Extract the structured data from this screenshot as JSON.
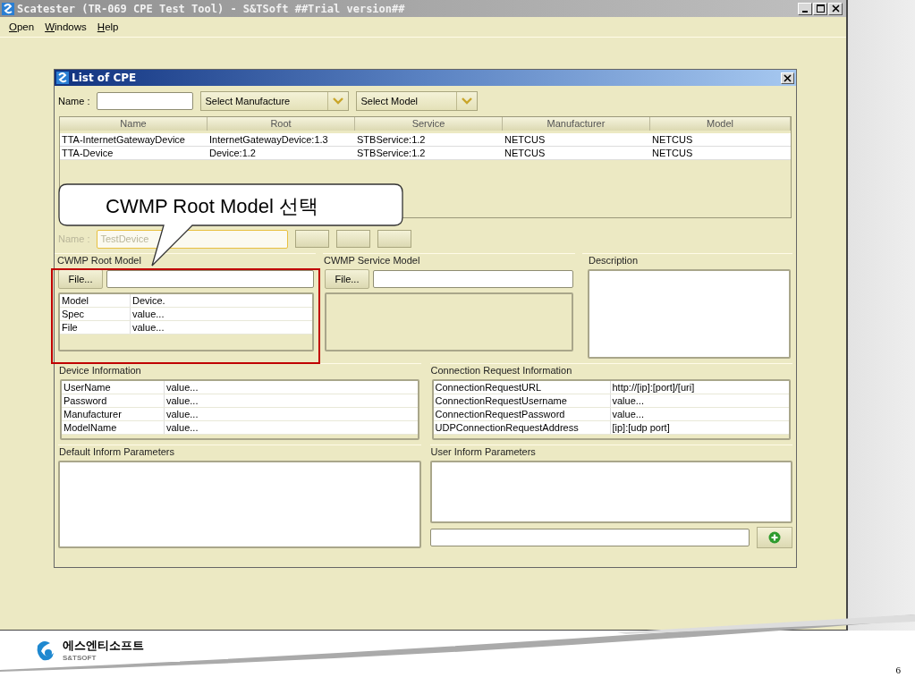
{
  "window": {
    "title": "Scatester (TR-069 CPE Test Tool) - S&TSoft ##Trial version##"
  },
  "menu": [
    {
      "key": "O",
      "rest": "pen"
    },
    {
      "key": "W",
      "rest": "indows"
    },
    {
      "key": "H",
      "rest": "elp"
    }
  ],
  "dialog": {
    "title": "List of CPE",
    "filter": {
      "name_label": "Name :",
      "manufacturer": "Select Manufacture",
      "model": "Select Model"
    },
    "table": {
      "columns": [
        "Name",
        "Root",
        "Service",
        "Manufacturer",
        "Model"
      ],
      "rows": [
        [
          "TTA-InternetGatewayDevice",
          "InternetGatewayDevice:1.3",
          "STBService:1.2",
          "NETCUS",
          "NETCUS"
        ],
        [
          "TTA-Device",
          "Device:1.2",
          "STBService:1.2",
          "NETCUS",
          "NETCUS"
        ]
      ]
    },
    "device": {
      "name_label": "Name :",
      "name_value": "TestDevice",
      "disabled": true
    },
    "root_model": {
      "title": "CWMP Root Model",
      "file_button": "File...",
      "properties": [
        [
          "Model",
          "Device."
        ],
        [
          "Spec",
          "value..."
        ],
        [
          "File",
          "value..."
        ]
      ]
    },
    "service_model": {
      "title": "CWMP Service Model",
      "file_button": "File..."
    },
    "description": {
      "title": "Description"
    },
    "device_information": {
      "title": "Device Information",
      "rows": [
        [
          "UserName",
          "value..."
        ],
        [
          "Password",
          "value..."
        ],
        [
          "Manufacturer",
          "value..."
        ],
        [
          "ModelName",
          "value..."
        ]
      ]
    },
    "connection_request": {
      "title": "Connection Request Information",
      "rows": [
        [
          "ConnectionRequestURL",
          "http://[ip]:[port]/[uri]"
        ],
        [
          "ConnectionRequestUsername",
          "value..."
        ],
        [
          "ConnectionRequestPassword",
          "value..."
        ],
        [
          "UDPConnectionRequestAddress",
          "[ip]:[udp port]"
        ]
      ]
    },
    "default_inform": {
      "title": "Default Inform Parameters"
    },
    "user_inform": {
      "title": "User Inform Parameters"
    }
  },
  "callout": {
    "text": "CWMP Root Model 선택"
  },
  "footer": {
    "company": "에스엔티소프트",
    "brand": "S&TSOFT",
    "page": "6"
  }
}
